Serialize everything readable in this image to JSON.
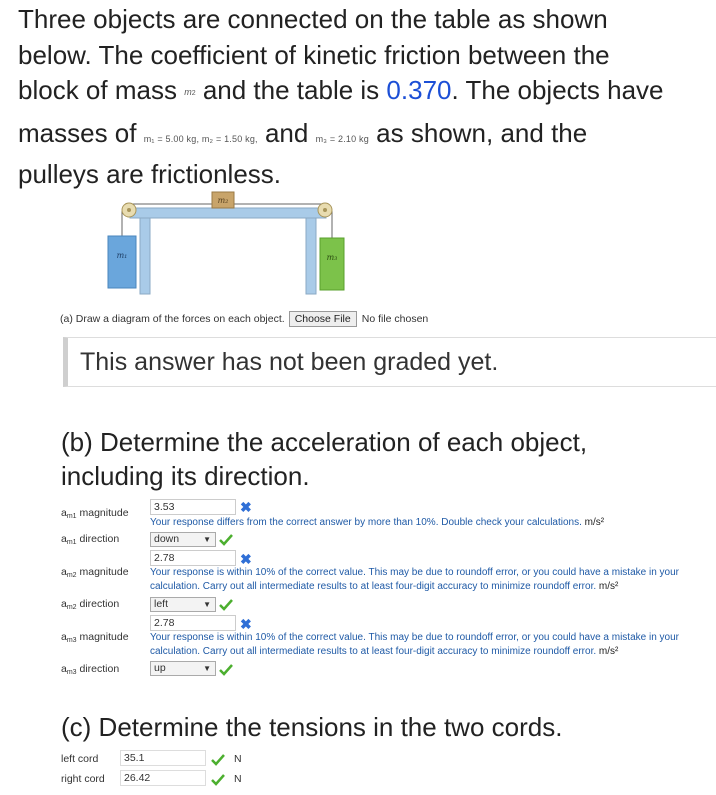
{
  "intro": {
    "line1": "Three objects are connected on the table as shown",
    "line2": "below. The coefficient of kinetic friction between the",
    "line3a": "block of mass",
    "m2_symbol": "m",
    "m2_sub": "2",
    "line3b": "and the table is",
    "mu": "0.370",
    "line3c": ". The objects have",
    "line4a": "masses of",
    "m1_text": "m₁ = 5.00 kg,  m₂ = 1.50 kg,",
    "and_word": "and",
    "m3_text": "m₃ = 2.10 kg",
    "line4b": "as shown, and the",
    "line5": "pulleys are frictionless."
  },
  "diagram": {
    "m1_label": "m₁",
    "m2_label": "m₂",
    "m3_label": "m₃",
    "m1_color": "#6aa6dc",
    "m2_color": "#c8a46a",
    "m3_color": "#7cc24a",
    "table_color": "#a9cbe8"
  },
  "part_a": {
    "prompt": "(a) Draw a diagram of the forces on each object.",
    "file_button": "Choose File",
    "file_status": "No file chosen"
  },
  "graded_box": {
    "text": "This answer has not been graded yet."
  },
  "part_b": {
    "line1": "(b) Determine the acceleration of each object,",
    "line2": "including its direction.",
    "rows": [
      {
        "label_pre": "a",
        "label_sub": "m1",
        "label_post": " magnitude",
        "value": "3.53",
        "status": "wrong",
        "msg1": "Your response differs from the correct answer by more than 10%. Double check your calculations.",
        "unit": "m/s²"
      },
      {
        "label_pre": "a",
        "label_sub": "m1",
        "label_post": " direction",
        "value": "down",
        "status": "correct"
      },
      {
        "label_pre": "a",
        "label_sub": "m2",
        "label_post": " magnitude",
        "value": "2.78",
        "status": "wrong",
        "msg1": "Your response is within 10% of the correct value. This may be due to roundoff error, or you could have a mistake in your",
        "msg2": "calculation. Carry out all intermediate results to at least four-digit accuracy to minimize roundoff error.",
        "unit": "m/s²"
      },
      {
        "label_pre": "a",
        "label_sub": "m2",
        "label_post": " direction",
        "value": "left",
        "status": "correct"
      },
      {
        "label_pre": "a",
        "label_sub": "m3",
        "label_post": " magnitude",
        "value": "2.78",
        "status": "wrong",
        "msg1": "Your response is within 10% of the correct value. This may be due to roundoff error, or you could have a mistake in your",
        "msg2": "calculation. Carry out all intermediate results to at least four-digit accuracy to minimize roundoff error.",
        "unit": "m/s²"
      },
      {
        "label_pre": "a",
        "label_sub": "m3",
        "label_post": " direction",
        "value": "up",
        "status": "correct"
      }
    ]
  },
  "part_c": {
    "title": "(c) Determine the tensions in the two cords.",
    "rows": [
      {
        "label": "left cord",
        "value": "35.1",
        "unit": "N",
        "status": "correct"
      },
      {
        "label": "right cord",
        "value": "26.42",
        "unit": "N",
        "status": "correct"
      }
    ]
  },
  "colors": {
    "wrong": "#2f6fd6",
    "correct": "#4caf2f",
    "link_blue": "#1c4fd6",
    "msg_blue": "#1f5aa6"
  }
}
